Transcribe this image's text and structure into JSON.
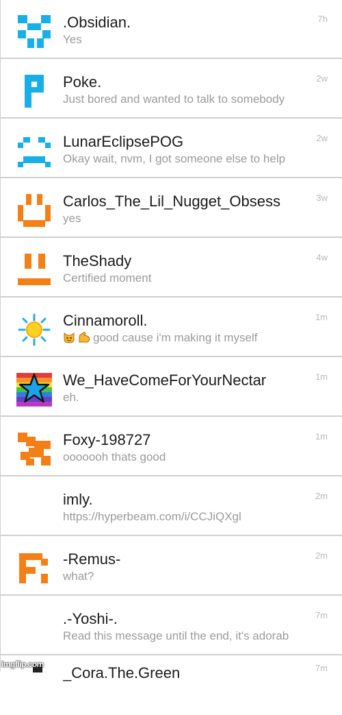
{
  "colors": {
    "blue": "#1aaee8",
    "orange": "#f57f17",
    "name": "#1a1a1a",
    "preview": "#9a9a9a",
    "time": "#b8b8b8"
  },
  "conversations": [
    {
      "name": ".Obsidian.",
      "preview": "Yes",
      "time": "7h",
      "avatar": "obsidian-avatar-icon"
    },
    {
      "name": "Poke.",
      "preview": "Just bored and wanted to talk to somebody",
      "time": "2w",
      "avatar": "poke-avatar-icon"
    },
    {
      "name": "LunarEclipsePOG",
      "preview": "Okay wait, nvm, I got someone else to help",
      "time": "2w",
      "avatar": "lunar-avatar-icon"
    },
    {
      "name": "Carlos_The_Lil_Nugget_Obsess",
      "preview": "yes",
      "time": "3w",
      "avatar": "carlos-avatar-icon"
    },
    {
      "name": "TheShady",
      "preview": "Certified moment",
      "time": "4w",
      "avatar": "shady-avatar-icon"
    },
    {
      "name": "Cinnamoroll.",
      "preview": "good cause i'm making it myself",
      "time": "1m",
      "avatar": "sun-avatar-icon",
      "emoji": [
        "cat-face-icon",
        "flexed-arm-icon"
      ]
    },
    {
      "name": "We_HaveComeForYourNectar",
      "preview": "eh.",
      "time": "1m",
      "avatar": "rainbow-star-avatar-icon"
    },
    {
      "name": "Foxy-198727",
      "preview": "ooooooh thats good",
      "time": "1m",
      "avatar": "foxy-avatar-icon"
    },
    {
      "name": "imly.",
      "preview": "https://hyperbeam.com/i/CCJiQXgl",
      "time": "2m",
      "avatar": ""
    },
    {
      "name": "-Remus-",
      "preview": "what?",
      "time": "2m",
      "avatar": "remus-avatar-icon"
    },
    {
      "name": ".-Yoshi-.",
      "preview": "Read this message until the end, it's adorab",
      "time": "7m",
      "avatar": ""
    },
    {
      "name": "_Cora.The.Green",
      "preview": "",
      "time": "7m",
      "avatar": ""
    }
  ],
  "watermark": "imgflip.com"
}
